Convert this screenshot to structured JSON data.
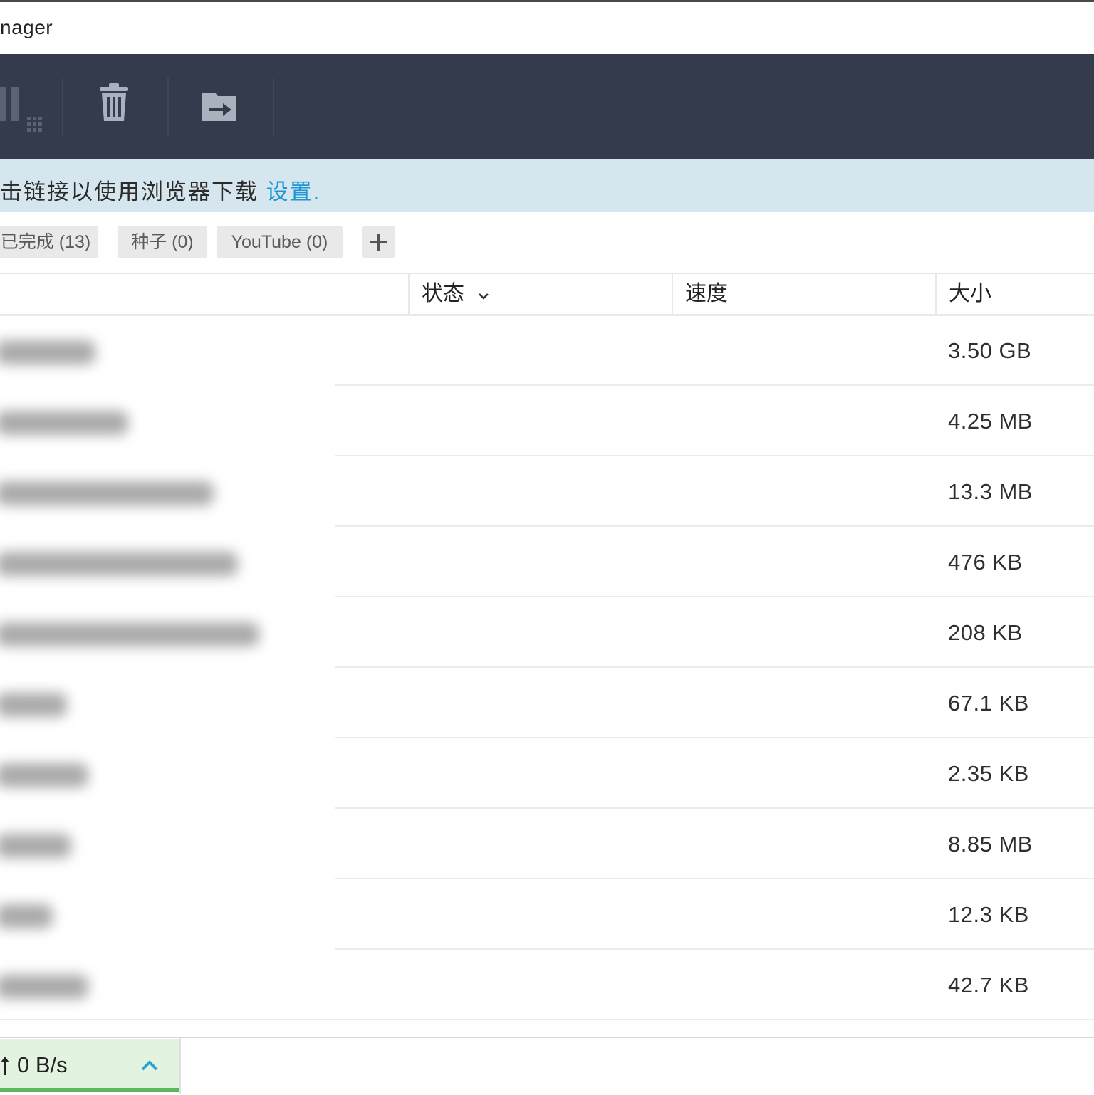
{
  "window": {
    "title": "nager"
  },
  "toolbar": {
    "buttons": [
      {
        "icon": "pause-all-icon"
      },
      {
        "icon": "trash-icon"
      },
      {
        "icon": "move-to-folder-icon"
      }
    ]
  },
  "notice": {
    "text": "击链接以使用浏览器下载 ",
    "link": "设置",
    "suffix": "."
  },
  "tabs": [
    {
      "label": "已完成 (13)"
    },
    {
      "label": "种子 (0)"
    },
    {
      "label": "YouTube (0)"
    }
  ],
  "table": {
    "columns": {
      "status": "状态",
      "speed": "速度",
      "size": "大小"
    },
    "rows": [
      {
        "size": "3.50 GB"
      },
      {
        "size": "4.25 MB"
      },
      {
        "size": "13.3 MB"
      },
      {
        "size": "476 KB"
      },
      {
        "size": "208 KB"
      },
      {
        "size": "67.1 KB"
      },
      {
        "size": "2.35 KB"
      },
      {
        "size": "8.85 MB"
      },
      {
        "size": "12.3 KB"
      },
      {
        "size": "42.7 KB"
      }
    ]
  },
  "statusbar": {
    "upload_speed": "0 B/s"
  },
  "colors": {
    "toolbar_bg": "#333b4d",
    "notice_bg": "#d5e6ee",
    "link": "#1e96d6",
    "speed_bg": "#e2f4df",
    "speed_bar": "#5cb85c",
    "chevron": "#2aa4d8"
  }
}
